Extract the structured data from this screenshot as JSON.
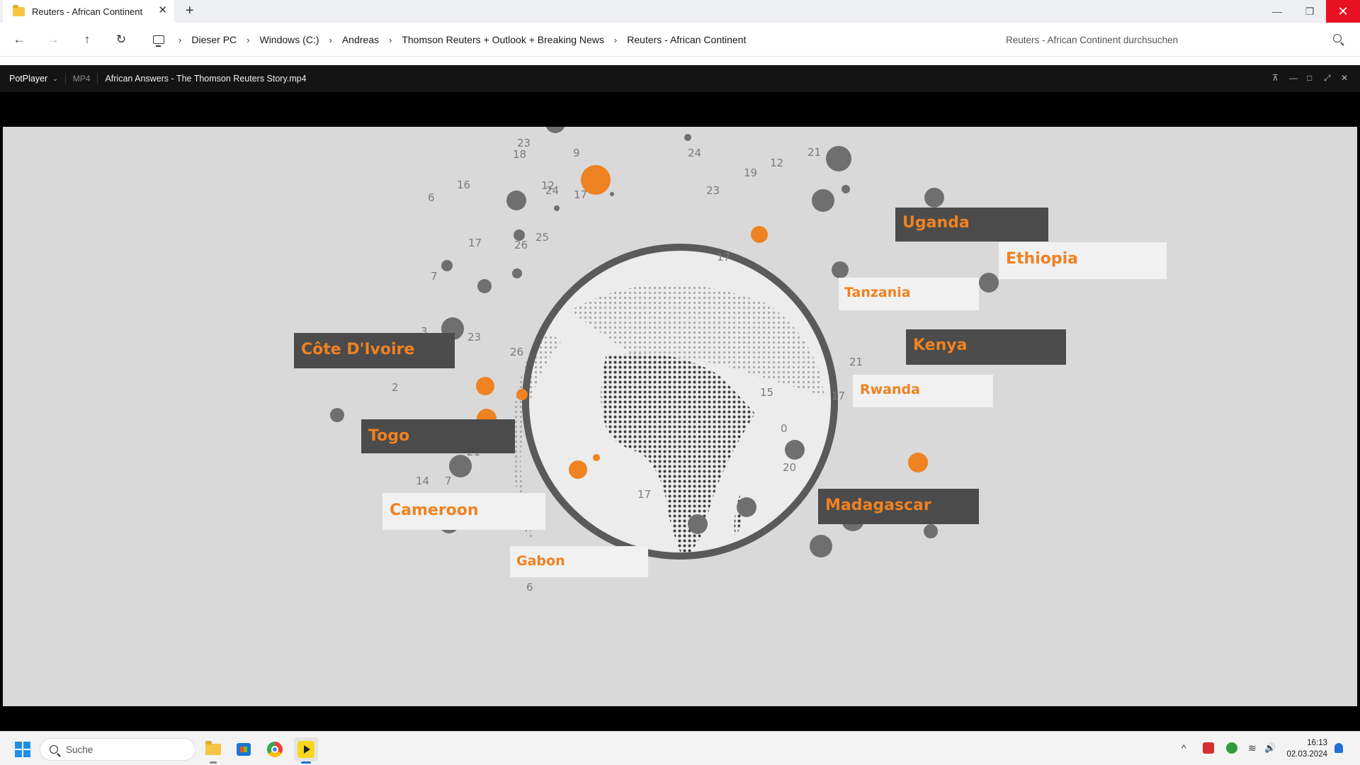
{
  "explorer": {
    "tab_title": "Reuters - African Continent",
    "tab_close": "✕",
    "new_tab": "+",
    "breadcrumbs": [
      "Dieser PC",
      "Windows (C:)",
      "Andreas",
      "Thomson Reuters + Outlook + Breaking News",
      "Reuters - African Continent"
    ],
    "search_placeholder": "Reuters - African Continent durchsuchen",
    "nav": {
      "back": "←",
      "forward": "→",
      "up": "↑",
      "refresh": "↻"
    },
    "window_controls": {
      "minimize": "—",
      "restore": "❐",
      "close": "✕"
    }
  },
  "player": {
    "app_name": "PotPlayer",
    "format": "MP4",
    "file_name": "African Answers - The Thomson Reuters Story.mp4",
    "controls": {
      "pin": "⊼",
      "minimize": "—",
      "maximize": "□",
      "fullscreen": "⤢",
      "close": "✕"
    }
  },
  "video_frame": {
    "country_labels_dark": [
      "Uganda",
      "Kenya",
      "Côte D'Ivoire",
      "Togo",
      "Madagascar"
    ],
    "country_labels_light": [
      "Ethiopia",
      "Tanzania",
      "Rwanda",
      "Cameroon",
      "Gabon"
    ],
    "numbers": [
      "23",
      "18",
      "9",
      "24",
      "19",
      "12",
      "21",
      "16",
      "6",
      "12",
      "24",
      "17",
      "23",
      "17",
      "26",
      "25",
      "7",
      "17",
      "3",
      "23",
      "26",
      "21",
      "2",
      "15",
      "17",
      "0",
      "21",
      "14",
      "7",
      "20",
      "17",
      "6"
    ],
    "colors": {
      "accent": "#ef8221",
      "dot": "#6f6f6f",
      "background": "#d9d9d9",
      "label_dark": "#4b4b4b"
    }
  },
  "taskbar": {
    "search_placeholder": "Suche",
    "apps": [
      "file-explorer",
      "microsoft-store",
      "chrome",
      "potplayer"
    ],
    "clock_time": "16:13",
    "clock_date": "02.03.2024",
    "tray_chevron": "^",
    "tray_wifi": "≋",
    "tray_volume": "🔊"
  }
}
